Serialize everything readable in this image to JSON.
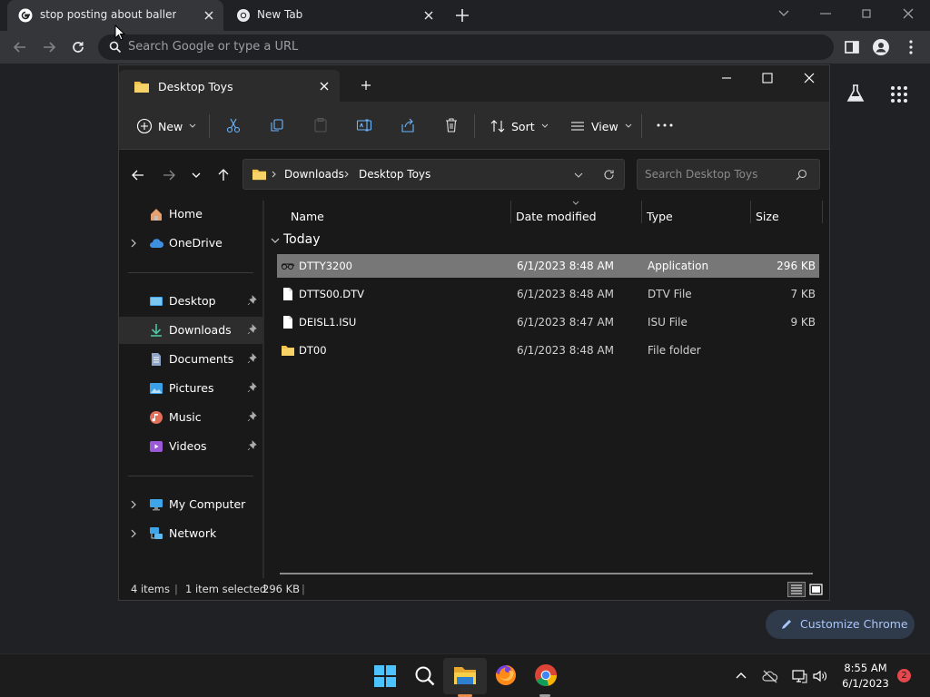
{
  "chrome": {
    "tabs": [
      {
        "title": "stop posting about baller - Google Search"
      },
      {
        "title": "New Tab"
      }
    ],
    "omnibox_placeholder": "Search Google or type a URL",
    "customize_label": "Customize Chrome"
  },
  "explorer": {
    "tab_title": "Desktop Toys",
    "cmdbar": {
      "new": "New",
      "sort": "Sort",
      "view": "View"
    },
    "breadcrumb": [
      "Downloads",
      "Desktop Toys"
    ],
    "search_placeholder": "Search Desktop Toys",
    "nav": {
      "home": "Home",
      "onedrive": "OneDrive",
      "desktop": "Desktop",
      "downloads": "Downloads",
      "documents": "Documents",
      "pictures": "Pictures",
      "music": "Music",
      "videos": "Videos",
      "my_computer": "My Computer",
      "network": "Network"
    },
    "columns": {
      "name": "Name",
      "date": "Date modified",
      "type": "Type",
      "size": "Size"
    },
    "group": "Today",
    "files": [
      {
        "name": "DTTY3200",
        "date": "6/1/2023 8:48 AM",
        "type": "Application",
        "size": "296 KB"
      },
      {
        "name": "DTTS00.DTV",
        "date": "6/1/2023 8:48 AM",
        "type": "DTV File",
        "size": "7 KB"
      },
      {
        "name": "DEISL1.ISU",
        "date": "6/1/2023 8:47 AM",
        "type": "ISU File",
        "size": "9 KB"
      },
      {
        "name": "DT00",
        "date": "6/1/2023 8:48 AM",
        "type": "File folder",
        "size": ""
      }
    ],
    "status": {
      "items": "4 items",
      "selected": "1 item selected",
      "size": "296 KB"
    }
  },
  "taskbar": {
    "time": "8:55 AM",
    "date": "6/1/2023",
    "notifications": "2"
  },
  "colors": {
    "accent": "#a8c7fa",
    "selection": "#777777",
    "folder": "#f0c24e"
  }
}
